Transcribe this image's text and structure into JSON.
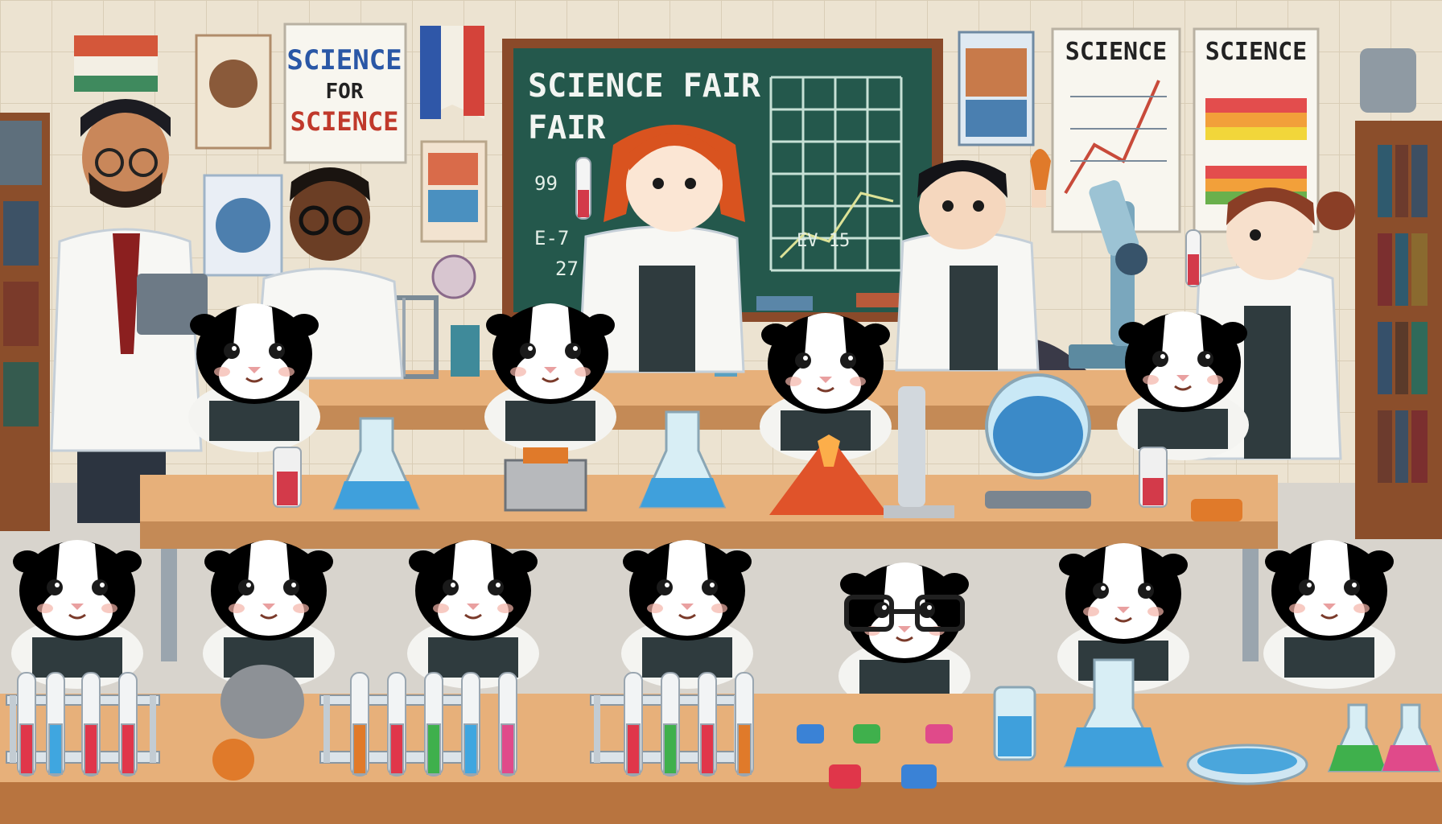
{
  "scene": {
    "chalkboard_line1": "SCIENCE FAIR",
    "chalkboard_line2": "FAIR",
    "chalk_scribble_1": "99",
    "chalk_scribble_2": "E-7",
    "chalk_scribble_3": "27",
    "chalk_graph_note": "EV 15",
    "poster_left_line1": "SCIENCE",
    "poster_left_line2": "FOR",
    "poster_left_line3": "SCIENCE",
    "poster_graph_title": "SCIENCE",
    "poster_bars_title": "SCIENCE"
  },
  "colors": {
    "wall": "#ece3d1",
    "chalkboard": "#24584c",
    "chalk_frame": "#8a4a2a",
    "table": "#e7b07a",
    "lab_coat": "#f7f7f4",
    "guinea_orange": "#c9531c",
    "guinea_black": "#2c2c36",
    "guinea_pink": "#e0528a"
  }
}
